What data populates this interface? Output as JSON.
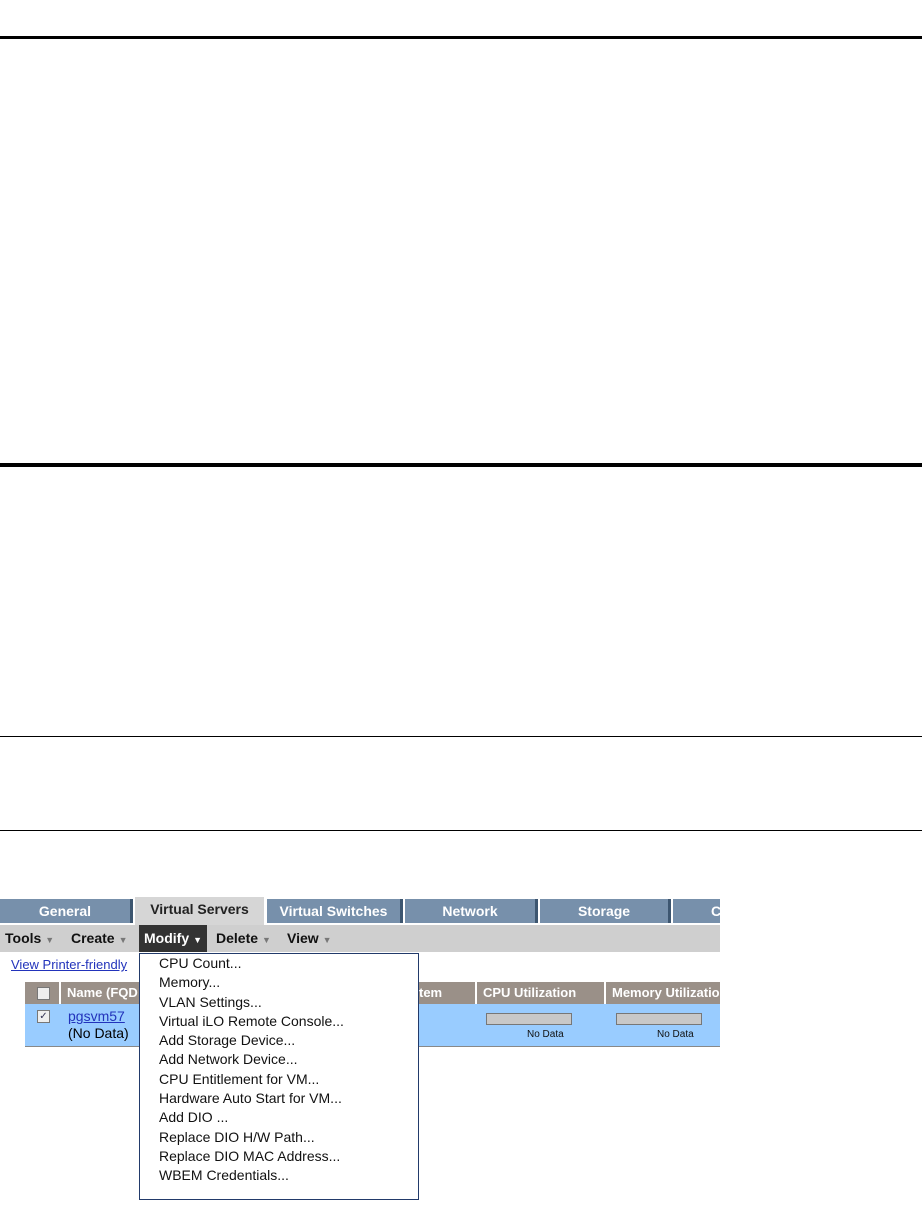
{
  "tabs": [
    {
      "label": "General"
    },
    {
      "label": "Virtual Servers"
    },
    {
      "label": "Virtual Switches"
    },
    {
      "label": "Network"
    },
    {
      "label": "Storage"
    },
    {
      "label": "Co"
    }
  ],
  "toolbar": {
    "items": [
      {
        "label": "Tools"
      },
      {
        "label": "Create"
      },
      {
        "label": "Modify"
      },
      {
        "label": "Delete"
      },
      {
        "label": "View"
      }
    ]
  },
  "link": "View Printer-friendly",
  "table": {
    "headers": [
      "Name (FQD",
      "tem",
      "CPU Utilization",
      "Memory Utilizatio"
    ],
    "row": {
      "checked": true,
      "name": "pgsvm57",
      "sub": "(No Data)",
      "cpu": "No Data",
      "mem": "No Data"
    }
  },
  "menu": {
    "items": [
      "CPU Count...",
      "Memory...",
      "VLAN Settings...",
      "Virtual iLO Remote Console...",
      "Add Storage Device...",
      "Add Network Device...",
      "CPU Entitlement for VM...",
      "Hardware Auto Start for VM...",
      "Add DIO ...",
      "Replace DIO H/W Path...",
      "Replace DIO MAC Address...",
      "WBEM Credentials..."
    ]
  },
  "colors": {
    "tab": "#7790ab",
    "header": "#9a9088",
    "row": "#99ccff",
    "toolbar": "#cfcfcf"
  }
}
